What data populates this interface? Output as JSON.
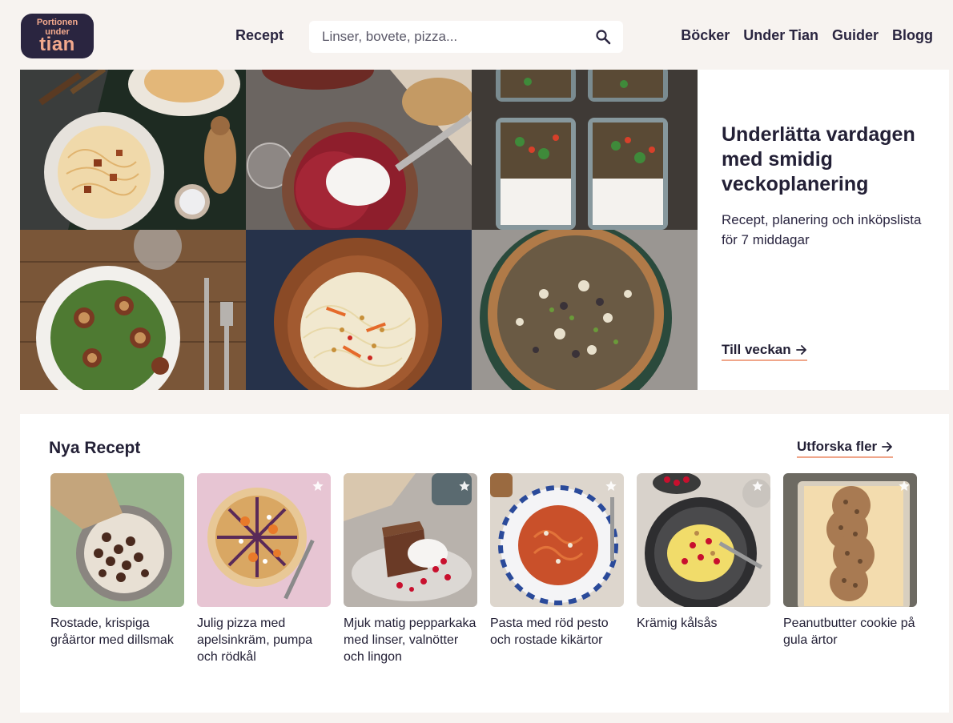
{
  "logo": {
    "line1": "Portionen",
    "line2": "under",
    "line3": "tian"
  },
  "nav": {
    "recept": "Recept",
    "right": [
      "Böcker",
      "Under Tian",
      "Guider",
      "Blogg"
    ]
  },
  "search": {
    "placeholder": "Linser, bovete, pizza..."
  },
  "hero": {
    "title": "Underlätta vardagen med smidig veckoplanering",
    "subtitle": "Recept, planering och inköpslista för 7 middagar",
    "link": "Till veckan"
  },
  "recipes": {
    "title": "Nya Recept",
    "explore": "Utforska fler",
    "items": [
      {
        "title": "Rostade, krispiga gråärtor med dillsmak",
        "star": false
      },
      {
        "title": "Julig pizza med apelsinkräm, pumpa och rödkål",
        "star": true
      },
      {
        "title": "Mjuk matig pepparkaka med linser, valnötter och lingon",
        "star": true
      },
      {
        "title": "Pasta med röd pesto och rostade kikärtor",
        "star": true
      },
      {
        "title": "Krämig kålsås",
        "star": true
      },
      {
        "title": "Peanutbutter cookie på gula ärtor",
        "star": true
      }
    ]
  },
  "colors": {
    "brand_dark": "#2a2540",
    "accent_peach": "#f0a68a",
    "background": "#f7f3f0"
  }
}
